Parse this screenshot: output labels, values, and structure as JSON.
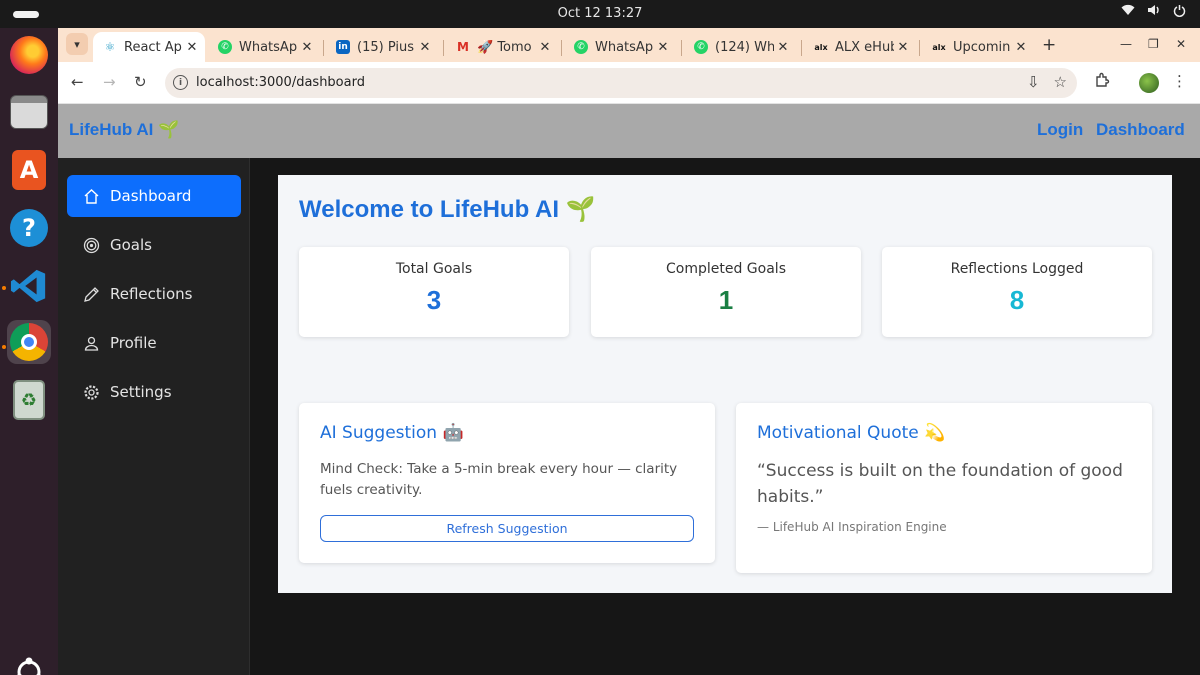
{
  "os": {
    "clock": "Oct 12  13:27",
    "tray": [
      "wifi-icon",
      "volume-icon",
      "power-icon"
    ]
  },
  "dock": {
    "apps": [
      "Firefox",
      "Files",
      "App Center",
      "Help",
      "Visual Studio Code",
      "Google Chrome",
      "Trash"
    ]
  },
  "browser": {
    "tabs": [
      {
        "title": "React App",
        "icon": "react-icon",
        "active": true
      },
      {
        "title": "WhatsApp",
        "icon": "whatsapp-icon"
      },
      {
        "title": "(15) Pius",
        "icon": "linkedin-icon"
      },
      {
        "title": "🚀 Tomo",
        "icon": "gmail-icon"
      },
      {
        "title": "WhatsApp",
        "icon": "whatsapp-icon"
      },
      {
        "title": "(124) Wh",
        "icon": "whatsapp-icon"
      },
      {
        "title": "ALX eHub",
        "icon": "alx-icon"
      },
      {
        "title": "Upcomin",
        "icon": "alx-icon"
      }
    ],
    "close_glyph": "✕",
    "new_tab_glyph": "+",
    "url": "localhost:3000/dashboard"
  },
  "app": {
    "brand": "LifeHub AI 🌱",
    "nav_links": [
      "Login",
      "Dashboard"
    ],
    "sidebar": [
      {
        "label": "Dashboard",
        "icon": "home-icon",
        "active": true
      },
      {
        "label": "Goals",
        "icon": "target-icon"
      },
      {
        "label": "Reflections",
        "icon": "pencil-icon"
      },
      {
        "label": "Profile",
        "icon": "user-icon"
      },
      {
        "label": "Settings",
        "icon": "gear-icon"
      }
    ],
    "welcome": "Welcome to LifeHub AI 🌱",
    "stats": [
      {
        "label": "Total Goals",
        "value": "3",
        "color": "#1e6fd9"
      },
      {
        "label": "Completed Goals",
        "value": "1",
        "color": "#1a7f43"
      },
      {
        "label": "Reflections Logged",
        "value": "8",
        "color": "#17b8d4"
      }
    ],
    "suggestion": {
      "title": "AI Suggestion 🤖",
      "text": "Mind Check: Take a 5-min break every hour — clarity fuels creativity.",
      "button": "Refresh Suggestion"
    },
    "quote": {
      "title": "Motivational Quote 💫",
      "text": "“Success is built on the foundation of good habits.”",
      "source": "— LifeHub AI Inspiration Engine"
    }
  },
  "colors": {
    "accent": "#1e6fd9",
    "sidebar_active": "#0d6efd",
    "tabstrip": "#fbe3cf"
  }
}
